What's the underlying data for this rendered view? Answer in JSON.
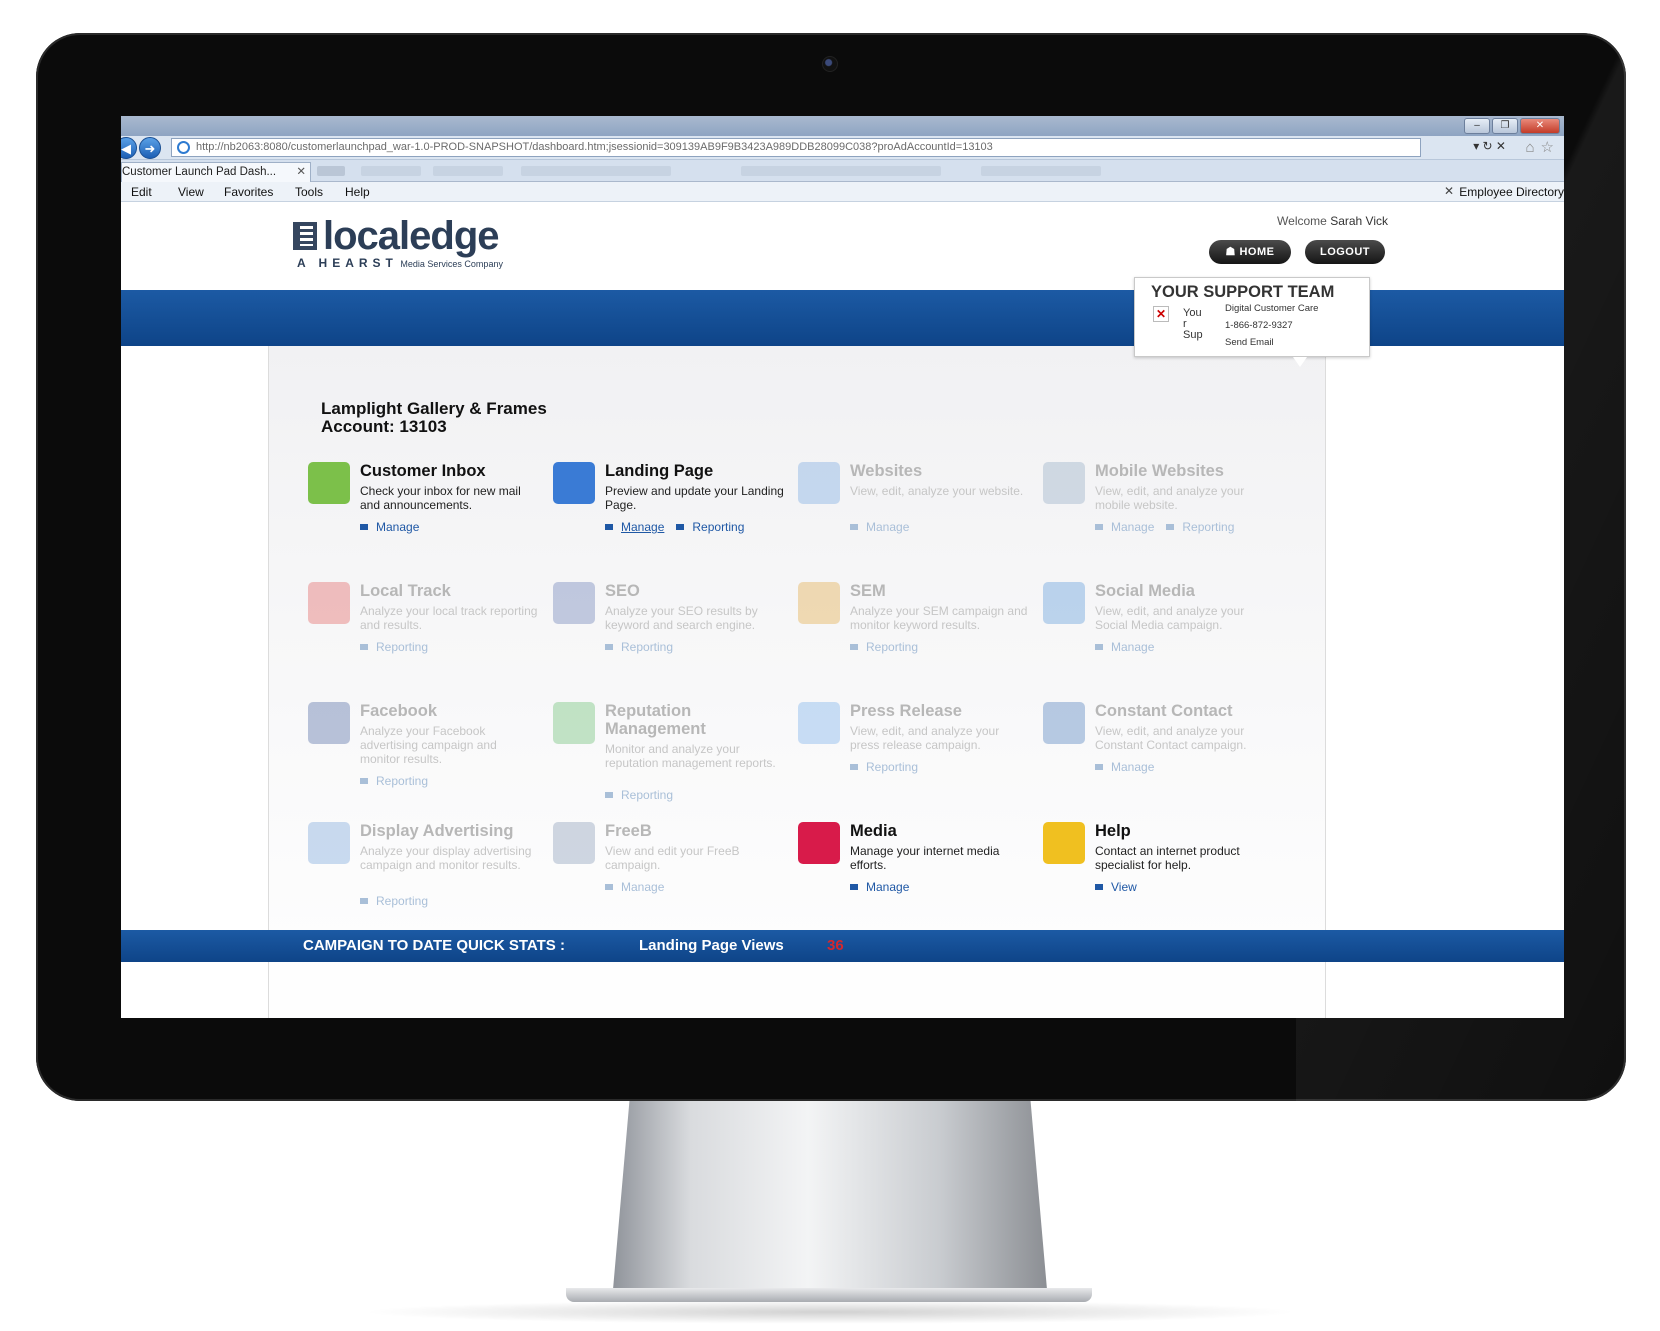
{
  "browser": {
    "url": "http://nb2063:8080/customerlaunchpad_war-1.0-PROD-SNAPSHOT/dashboard.htm;jsessionid=309139AB9F9B3423A989DDB28099C038?proAdAccountId=13103",
    "tab_title": "Customer Launch Pad Dash...",
    "menu": [
      "Edit",
      "View",
      "Favorites",
      "Tools",
      "Help"
    ],
    "employee_directory": "Employee Directory"
  },
  "header": {
    "logo_text": "localedge",
    "logo_sub_brand": "A HEARST",
    "logo_sub_text": "Media Services Company",
    "welcome_label": "Welcome",
    "user_name": "Sarah Vick",
    "home_label": "HOME",
    "logout_label": "LOGOUT"
  },
  "support": {
    "title": "YOUR SUPPORT TEAM",
    "image_alt": "You r Sup",
    "line1": "Digital Customer Care",
    "phone": "1-866-872-9327",
    "email_label": "Send Email"
  },
  "account": {
    "business": "Lamplight Gallery & Frames",
    "account_line": "Account: 13103"
  },
  "products": [
    {
      "title": "Customer Inbox",
      "desc": "Check your inbox for new mail and announcements.",
      "links": [
        "Manage"
      ],
      "enabled": true,
      "icon": "inbox-icon",
      "color": "#7cc04a"
    },
    {
      "title": "Landing Page",
      "desc": "Preview and update your Landing Page.",
      "links": [
        "Manage",
        "Reporting"
      ],
      "enabled": true,
      "icon": "monitor-cursor-icon",
      "color": "#3a7bd5"
    },
    {
      "title": "Websites",
      "desc": "View, edit, analyze your website.",
      "links": [
        "Manage"
      ],
      "enabled": false,
      "icon": "globe-icon",
      "color": "#6aa0e0"
    },
    {
      "title": "Mobile Websites",
      "desc": "View, edit, and analyze your mobile website.",
      "links": [
        "Manage",
        "Reporting"
      ],
      "enabled": false,
      "icon": "mobile-phone-icon",
      "color": "#8aa2c0"
    },
    {
      "title": "Local Track",
      "desc": "Analyze your local track reporting and results.",
      "links": [
        "Reporting"
      ],
      "enabled": false,
      "icon": "growth-chart-icon",
      "color": "#e05050"
    },
    {
      "title": "SEO",
      "desc": "Analyze your SEO results by keyword and search engine.",
      "links": [
        "Reporting"
      ],
      "enabled": false,
      "icon": "seo-magnifier-icon",
      "color": "#5a6fb0"
    },
    {
      "title": "SEM",
      "desc": "Analyze your SEM campaign and monitor keyword results.",
      "links": [
        "Reporting"
      ],
      "enabled": false,
      "icon": "sem-target-icon",
      "color": "#e0a030"
    },
    {
      "title": "Social Media",
      "desc": "View, edit, and analyze your Social Media campaign.",
      "links": [
        "Manage"
      ],
      "enabled": false,
      "icon": "people-icon",
      "color": "#4a8fd8"
    },
    {
      "title": "Facebook",
      "desc": "Analyze your Facebook advertising campaign and monitor results.",
      "links": [
        "Reporting"
      ],
      "enabled": false,
      "icon": "facebook-icon",
      "color": "#3b5998"
    },
    {
      "title": "Reputation Management",
      "desc": "Monitor and analyze your reputation management reports.",
      "links": [
        "Reporting"
      ],
      "enabled": false,
      "icon": "speech-bubbles-icon",
      "color": "#5ab860"
    },
    {
      "title": "Press Release",
      "desc": "View, edit, and analyze your press release campaign.",
      "links": [
        "Reporting"
      ],
      "enabled": false,
      "icon": "document-icon",
      "color": "#6aa6e8"
    },
    {
      "title": "Constant Contact",
      "desc": "View, edit, and analyze your Constant Contact campaign.",
      "links": [
        "Manage"
      ],
      "enabled": false,
      "icon": "constant-contact-logo-icon",
      "color": "#3a6fb5"
    },
    {
      "title": "Display Advertising",
      "desc": "Analyze your display advertising campaign and monitor results.",
      "links": [
        "Reporting"
      ],
      "enabled": false,
      "icon": "display-ad-icon",
      "color": "#6a9ad8"
    },
    {
      "title": "FreeB",
      "desc": "View and edit your FreeB campaign.",
      "links": [
        "Manage"
      ],
      "enabled": false,
      "icon": "calculator-icon",
      "color": "#7a90b0"
    },
    {
      "title": "Media",
      "desc": "Manage your internet media efforts.",
      "links": [
        "Manage"
      ],
      "enabled": true,
      "icon": "video-camera-icon",
      "color": "#d81b4a"
    },
    {
      "title": "Help",
      "desc": "Contact an internet product specialist for help.",
      "links": [
        "View"
      ],
      "enabled": true,
      "icon": "help-person-icon",
      "color": "#f0c020"
    }
  ],
  "stats": {
    "label": "CAMPAIGN TO DATE QUICK STATS :",
    "metric_label": "Landing Page Views",
    "metric_value": "36"
  }
}
